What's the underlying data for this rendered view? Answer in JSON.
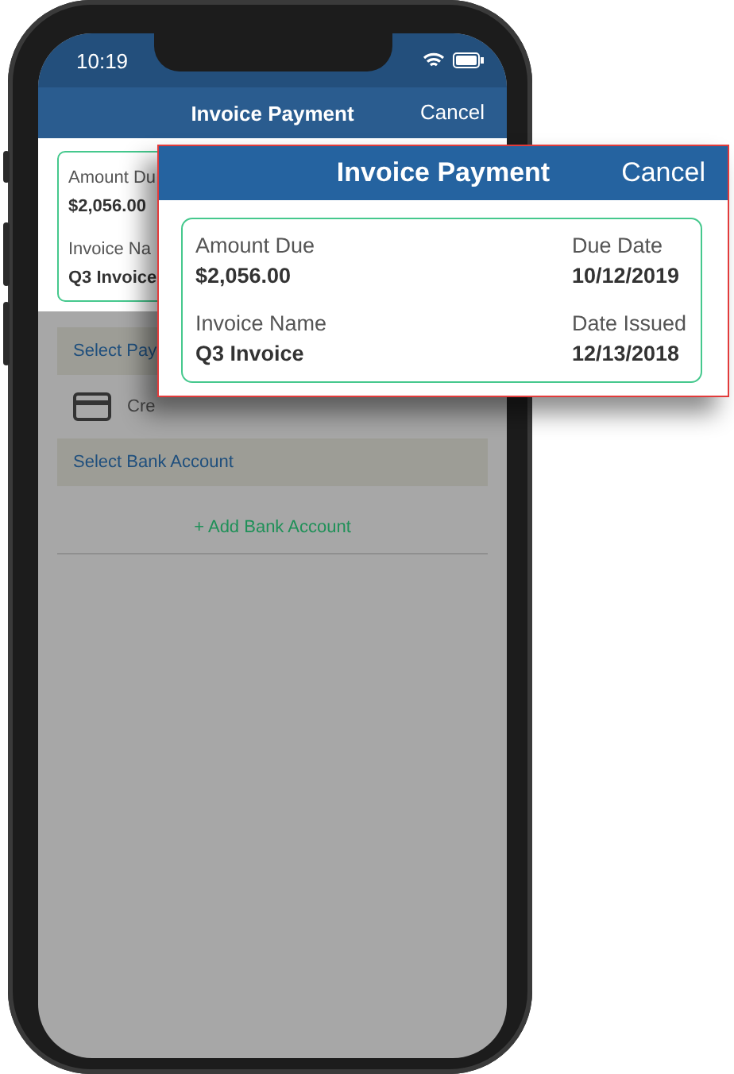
{
  "status_bar": {
    "time": "10:19"
  },
  "nav_bar": {
    "title": "Invoice Payment",
    "cancel": "Cancel"
  },
  "invoice_card": {
    "fields": [
      {
        "label": "Amount Du",
        "value": "$2,056.00"
      },
      {
        "label": "Invoice Na",
        "value": "Q3 Invoice"
      }
    ]
  },
  "payment_options": [
    {
      "kind": "band",
      "label": "Select Pay"
    },
    {
      "kind": "method",
      "label": "Cre"
    },
    {
      "kind": "band",
      "label": "Select Bank Account"
    },
    {
      "kind": "link",
      "label": "+ Add Bank Account"
    }
  ],
  "callout": {
    "title": "Invoice Payment",
    "cancel": "Cancel",
    "fields": [
      {
        "label": "Amount Due",
        "value": "$2,056.00"
      },
      {
        "label": "Due Date",
        "value": "10/12/2019"
      },
      {
        "label": "Invoice Name",
        "value": "Q3 Invoice"
      },
      {
        "label": "Date Issued",
        "value": "12/13/2018"
      }
    ]
  }
}
